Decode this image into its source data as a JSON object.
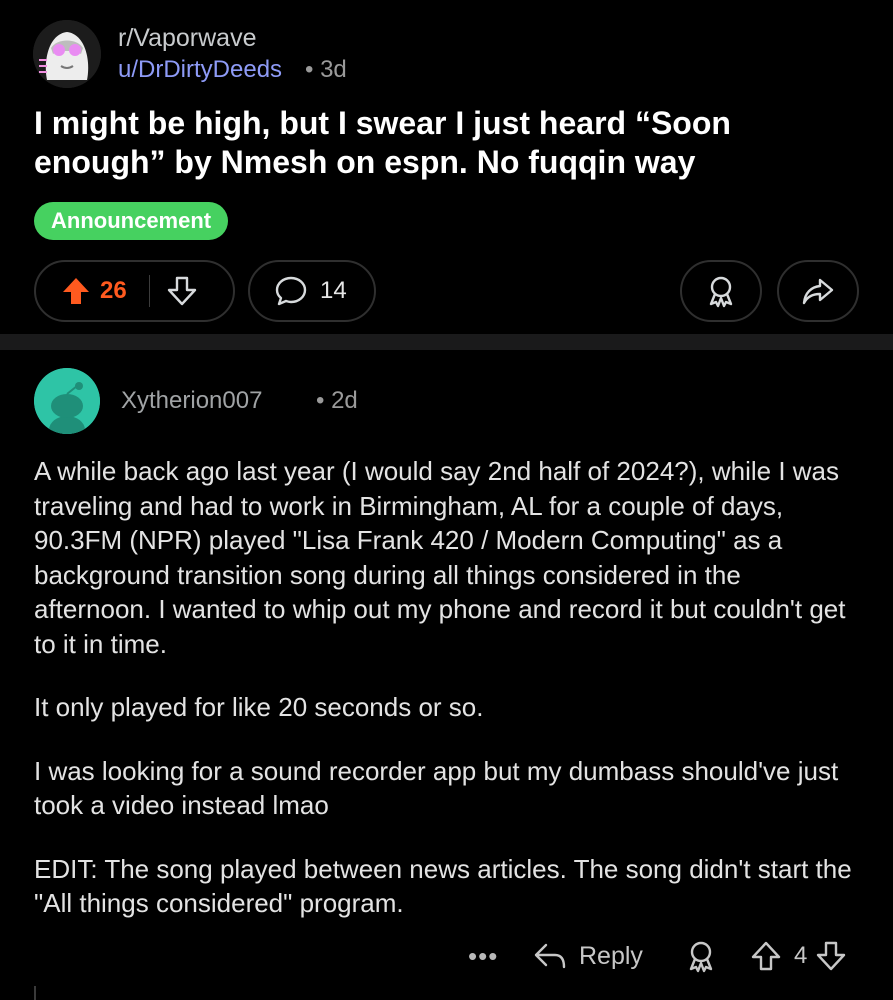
{
  "post": {
    "subreddit": "r/Vaporwave",
    "author": "u/DrDirtyDeeds",
    "time": "• 3d",
    "title": "I might be high, but I swear I just heard “Soon enough” by Nmesh on espn. No fuqqin way",
    "flair": "Announcement",
    "upvotes": "26",
    "comments": "14"
  },
  "comment": {
    "user": "Xytherion007",
    "time": "• 2d",
    "paragraphs": [
      "A while back ago last year (I would say 2nd half of 2024?), while I was traveling and had to work in Birmingham, AL for a couple of days, 90.3FM (NPR) played \"Lisa Frank 420 / Modern Computing\" as a background transition song during all things considered in the afternoon. I wanted to whip out my phone and record it but couldn't get to it in time.",
      "It only played for like 20 seconds or so.",
      "I was looking for a sound recorder app but my dumbass should've just took a video instead lmao",
      "EDIT: The song played between news articles. The song didn't start the \"All things considered\" program."
    ],
    "more": "•••",
    "reply_label": "Reply",
    "votes": "4"
  },
  "icons": [
    "upvote-icon",
    "downvote-icon",
    "comment-icon",
    "award-icon",
    "share-icon",
    "reply-icon",
    "more-icon"
  ],
  "colors": {
    "accent_upvote": "#ff5a1f",
    "flair_bg": "#46d160",
    "author_link": "#8e9bf7",
    "subreddit_avatar_bg": "#222222",
    "user_avatar_bg": "#2ec4a6"
  }
}
